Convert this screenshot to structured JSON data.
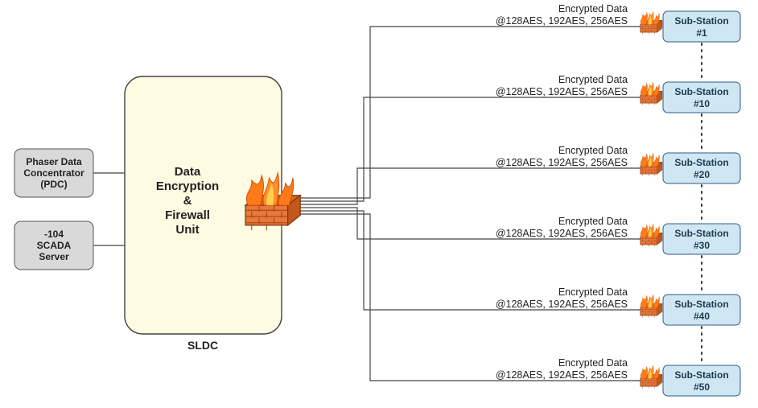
{
  "left_boxes": [
    {
      "line1": "Phaser Data",
      "line2": "Concentrator",
      "line3": "(PDC)"
    },
    {
      "line1": "-104",
      "line2": "SCADA",
      "line3": "Server"
    }
  ],
  "center": {
    "line1": "Data",
    "line2": "Encryption",
    "line3": "&",
    "line4": "Firewall",
    "line5": "Unit"
  },
  "sldc_label": "SLDC",
  "edge_label": {
    "line1": "Encrypted Data",
    "line2": "@128AES, 192AES, 256AES"
  },
  "substations": [
    {
      "line1": "Sub-Station",
      "line2": "#1"
    },
    {
      "line1": "Sub-Station",
      "line2": "#10"
    },
    {
      "line1": "Sub-Station",
      "line2": "#20"
    },
    {
      "line1": "Sub-Station",
      "line2": "#30"
    },
    {
      "line1": "Sub-Station",
      "line2": "#40"
    },
    {
      "line1": "Sub-Station",
      "line2": "#50"
    }
  ]
}
